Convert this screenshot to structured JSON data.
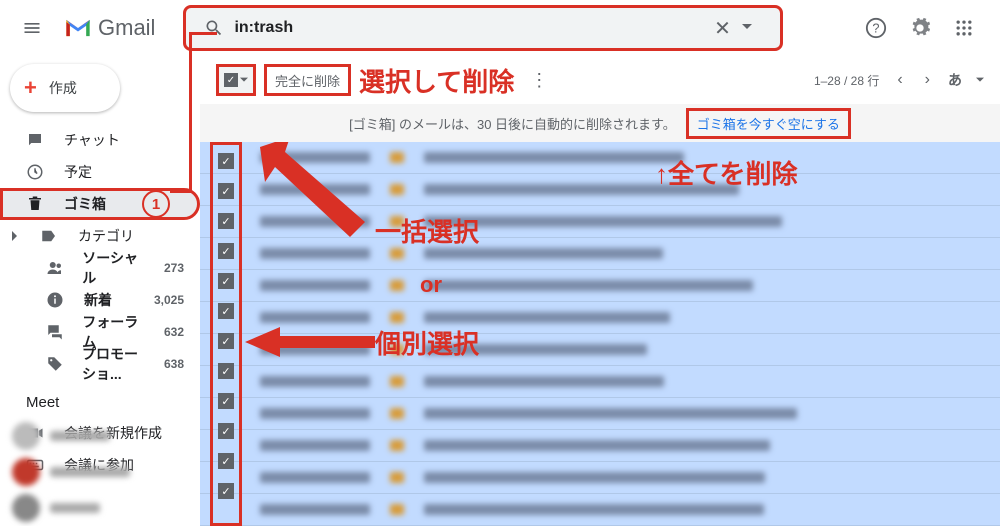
{
  "header": {
    "app_name": "Gmail",
    "search_value": "in:trash"
  },
  "compose_label": "作成",
  "sidebar": {
    "items": [
      {
        "icon": "chat",
        "label": "チャット",
        "count": ""
      },
      {
        "icon": "clock",
        "label": "予定",
        "count": ""
      },
      {
        "icon": "trash",
        "label": "ゴミ箱",
        "count": "",
        "selected": true
      },
      {
        "icon": "caret",
        "label": "カテゴリ",
        "count": ""
      }
    ],
    "sub": [
      {
        "icon": "people",
        "label": "ソーシャル",
        "count": "273"
      },
      {
        "icon": "info",
        "label": "新着",
        "count": "3,025"
      },
      {
        "icon": "forum",
        "label": "フォーラム",
        "count": "632"
      },
      {
        "icon": "tag",
        "label": "プロモーショ...",
        "count": "638"
      }
    ],
    "meet_header": "Meet",
    "meet_items": [
      {
        "icon": "video",
        "label": "会議を新規作成"
      },
      {
        "icon": "keyboard",
        "label": "会議に参加"
      }
    ]
  },
  "circle_anno": "1",
  "toolbar": {
    "delete_label": "完全に削除",
    "pagination": "1–28 / 28 行",
    "lang": "あ"
  },
  "banner": {
    "text": "[ゴミ箱] のメールは、30 日後に自動的に削除されます。",
    "link": "ゴミ箱を今すぐ空にする"
  },
  "annotations": {
    "select_delete": "選択して削除",
    "delete_all": "↑全てを削除",
    "bulk_select": "一括選択",
    "or": "or",
    "individual_select": "個別選択"
  },
  "row_count": 12
}
